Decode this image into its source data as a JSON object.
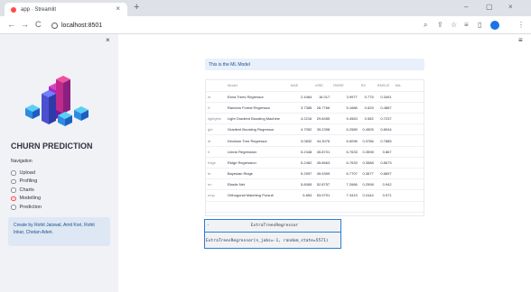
{
  "browser": {
    "tab_title": "app · Streamlit",
    "tab_close": "×",
    "new_tab": "+",
    "url": "localhost:8501",
    "nav": {
      "back": "←",
      "forward": "→",
      "reload": "C"
    },
    "window": {
      "minimize": "–",
      "restore": "▢",
      "close": "×"
    },
    "icons": [
      "zoom-icon",
      "share-icon",
      "star-icon",
      "extensions-icon",
      "sidebar-icon",
      "profile-icon",
      "menu-icon"
    ]
  },
  "sidebar": {
    "close": "×",
    "app_title": "CHURN PREDICTION",
    "nav_label": "Navigation",
    "options": [
      {
        "label": "Upload",
        "selected": false
      },
      {
        "label": "Profiling",
        "selected": false
      },
      {
        "label": "Charts",
        "selected": false
      },
      {
        "label": "Modelling",
        "selected": true
      },
      {
        "label": "Prediction",
        "selected": false
      }
    ],
    "credits": "Create by Rohit Jaiswal, Amit Kori, Rohit Inkar, Chetan Aderi."
  },
  "main": {
    "menu": "≡",
    "info": "This is the ML Model",
    "table": {
      "columns": [
        "",
        "Model",
        "MAE",
        "MSE",
        "RMSE",
        "R2",
        "RMSLE",
        "MA"
      ],
      "rows": [
        [
          "et",
          "Extra Trees Regressor",
          "2.4464",
          "16.017",
          "3.9977",
          "0.775",
          "0.3491",
          ""
        ],
        [
          "rf",
          "Random Forest Regressor",
          "3.7385",
          "26.7766",
          "5.1686",
          "0.625",
          "0.4867",
          ""
        ],
        [
          "lightgbm",
          "Light Gradient Boosting Machine",
          "4.2216",
          "29.8455",
          "5.4563",
          "0.582",
          "0.7237",
          ""
        ],
        [
          "gbr",
          "Gradient Boosting Regressor",
          "4.7052",
          "39.2398",
          "6.2589",
          "0.4505",
          "0.8044",
          ""
        ],
        [
          "dt",
          "Decision Tree Regressor",
          "3.0832",
          "44.3076",
          "6.6096",
          "0.3786",
          "0.7885",
          ""
        ],
        [
          "lr",
          "Linear Regression",
          "5.2448",
          "45.8701",
          "6.7633",
          "0.3598",
          "0.867",
          ""
        ],
        [
          "ridge",
          "Ridge Regression",
          "5.2462",
          "45.8663",
          "6.7633",
          "0.3588",
          "0.8673",
          ""
        ],
        [
          "br",
          "Bayesian Ridge",
          "5.2597",
          "45.9399",
          "6.7707",
          "0.3577",
          "0.8697",
          ""
        ],
        [
          "en",
          "Elastic Net",
          "5.8065",
          "52.8757",
          "7.2666",
          "0.2598",
          "0.942",
          ""
        ],
        [
          "omp",
          "Orthogonal Matching Pursuit",
          "5.854",
          "53.9791",
          "7.3419",
          "0.2444",
          "0.971",
          ""
        ],
        [
          "",
          "",
          "",
          "",
          "",
          "",
          "",
          ""
        ],
        [
          "",
          "",
          "",
          "",
          "",
          "",
          "",
          ""
        ]
      ]
    },
    "model_box": {
      "collapse": "-",
      "name": "ExtraTreesRegressor",
      "repr": "ExtraTreesRegressor(n_jobs=-1, random_state=5571)"
    }
  },
  "colors": {
    "accent": "#ff4b4b",
    "info_bg": "#e7f0fb",
    "sidebar_bg": "#f0f2f6",
    "info_text": "#1e4f87"
  }
}
